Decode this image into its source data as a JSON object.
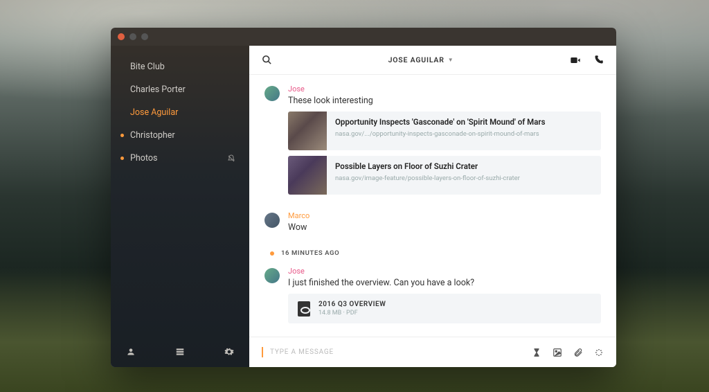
{
  "header": {
    "title": "JOSE AGUILAR"
  },
  "sidebar": {
    "items": [
      {
        "label": "Bite Club",
        "active": false,
        "unread": false,
        "muted": false
      },
      {
        "label": "Charles Porter",
        "active": false,
        "unread": false,
        "muted": false
      },
      {
        "label": "Jose Aguilar",
        "active": true,
        "unread": false,
        "muted": false
      },
      {
        "label": "Christopher",
        "active": false,
        "unread": true,
        "muted": false
      },
      {
        "label": "Photos",
        "active": false,
        "unread": true,
        "muted": true
      }
    ]
  },
  "messages": [
    {
      "sender": "Jose",
      "sender_kind": "jose",
      "text": "These look interesting",
      "links": [
        {
          "title": "Opportunity Inspects 'Gasconade' on 'Spirit Mound' of Mars",
          "url": "nasa.gov/.../opportunity-inspects-gasconade-on-spirit-mound-of-mars"
        },
        {
          "title": "Possible Layers on Floor of Suzhi Crater",
          "url": "nasa.gov/image-feature/possible-layers-on-floor-of-suzhi-crater"
        }
      ]
    },
    {
      "sender": "Marco",
      "sender_kind": "marco",
      "text": "Wow"
    }
  ],
  "divider": {
    "label": "16 MINUTES AGO"
  },
  "messages2": [
    {
      "sender": "Jose",
      "sender_kind": "jose",
      "text": "I just finished the overview. Can you have a look?",
      "file": {
        "name": "2016 Q3 OVERVIEW",
        "meta": "14.8 MB · PDF"
      }
    }
  ],
  "composer": {
    "placeholder": "TYPE A MESSAGE"
  }
}
